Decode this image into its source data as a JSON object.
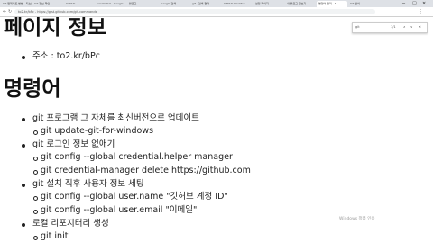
{
  "browser": {
    "tabs": [
      {
        "label": "Git 업데이트 방법 - 티스토리"
      },
      {
        "label": "Git 정보 확인"
      },
      {
        "label": "GitHub"
      },
      {
        "label": "credential - Google"
      },
      {
        "label": "블로그"
      },
      {
        "label": "Google 검색"
      },
      {
        "label": "git - 검색 결과"
      },
      {
        "label": "GitHub Desktop"
      },
      {
        "label": "설정 페이지"
      },
      {
        "label": "내 블로그 글쓰기"
      },
      {
        "label": "명령어 정리 - 1"
      },
      {
        "label": "Git 설치"
      }
    ],
    "url": "to2.kr/bPc - https://gist.github.com/git-commands",
    "find": {
      "value": "1/1",
      "query": "git"
    }
  },
  "page": {
    "heading_page_info": "페이지 정보",
    "address": "주소 : to2.kr/bPc",
    "heading_commands": "명령어",
    "items": [
      {
        "text": "git 프로그램 그 자체를 최신버전으로 업데이트",
        "sub": [
          "git update-git-for-windows"
        ]
      },
      {
        "text": "git 로그인 정보 없애기",
        "sub": [
          "git config --global credential.helper manager",
          "git credential-manager delete https://github.com"
        ]
      },
      {
        "text": "git 설치 직후 사용자 정보 세팅",
        "sub": [
          "git config --global user.name \"깃허브 계정 ID\"",
          "git config --global user.email \"이메일\""
        ]
      },
      {
        "text": "로컬 리포지터리 생성",
        "sub": [
          "git init"
        ]
      }
    ]
  },
  "overlay": {
    "watermark": "Windows 정품 인증"
  }
}
